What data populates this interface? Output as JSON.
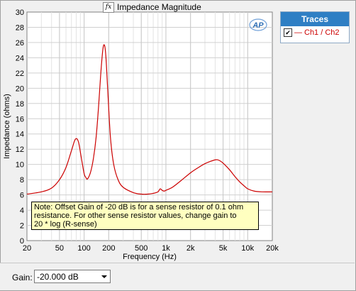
{
  "window": {
    "title": "Impedance Magnitude"
  },
  "traces_panel": {
    "header": "Traces",
    "items": [
      {
        "label": "Ch1 / Ch2",
        "checked": true,
        "color": "#cc0000"
      }
    ]
  },
  "note": {
    "text": "Note: Offset Gain of -20 dB is for a sense resistor of 0.1 ohm\nresistance. For other sense resistor values, change gain to\n20 * log (R-sense)"
  },
  "gain": {
    "label": "Gain:",
    "value": "-20.000 dB"
  },
  "logo_text": "AP",
  "chart_data": {
    "type": "line",
    "title": "",
    "xlabel": "Frequency (Hz)",
    "ylabel": "Impedance (ohms)",
    "xscale": "log",
    "xlim": [
      20,
      20000
    ],
    "ylim": [
      0,
      30
    ],
    "grid": true,
    "x_ticks": [
      20,
      50,
      100,
      200,
      500,
      1000,
      2000,
      5000,
      10000,
      20000
    ],
    "x_tick_labels": [
      "20",
      "50",
      "100",
      "200",
      "500",
      "1k",
      "2k",
      "5k",
      "10k",
      "20k"
    ],
    "y_ticks": [
      0,
      2,
      4,
      6,
      8,
      10,
      12,
      14,
      16,
      18,
      20,
      22,
      24,
      26,
      28,
      30
    ],
    "y_tick_labels": [
      "0",
      "2",
      "4",
      "6",
      "8",
      "10",
      "12",
      "14",
      "16",
      "18",
      "20",
      "22",
      "24",
      "26",
      "28",
      "30"
    ],
    "series": [
      {
        "name": "Ch1 / Ch2",
        "color": "#cc0000",
        "x": [
          20,
          30,
          40,
          50,
          60,
          70,
          78,
          85,
          92,
          100,
          105,
          110,
          120,
          130,
          140,
          150,
          160,
          170,
          178,
          185,
          195,
          210,
          230,
          260,
          300,
          400,
          500,
          600,
          700,
          800,
          850,
          900,
          950,
          1000,
          1200,
          1500,
          2000,
          2500,
          3000,
          3500,
          4000,
          4300,
          4700,
          5200,
          6000,
          7000,
          8000,
          9000,
          10000,
          12000,
          15000,
          20000
        ],
        "y": [
          6.1,
          6.4,
          6.9,
          8.0,
          9.6,
          11.8,
          13.3,
          13.0,
          11.0,
          8.8,
          8.3,
          8.1,
          9.0,
          10.8,
          13.5,
          17.5,
          22.0,
          25.2,
          25.6,
          24.0,
          19.5,
          13.5,
          10.0,
          8.0,
          7.0,
          6.3,
          6.1,
          6.1,
          6.2,
          6.4,
          6.8,
          6.6,
          6.5,
          6.6,
          7.0,
          7.8,
          8.9,
          9.6,
          10.1,
          10.4,
          10.6,
          10.6,
          10.4,
          10.0,
          9.3,
          8.4,
          7.7,
          7.2,
          6.8,
          6.5,
          6.4,
          6.4
        ]
      }
    ]
  }
}
